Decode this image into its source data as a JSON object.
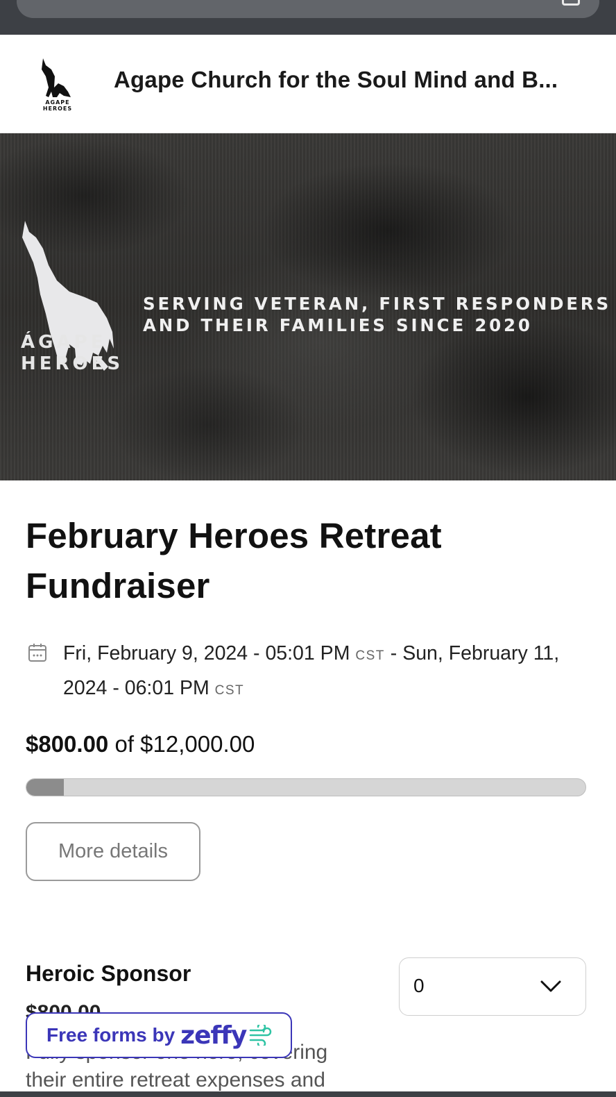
{
  "header": {
    "logo_text": "AGAPE HEROES",
    "title": "Agape Church for the Soul Mind and B..."
  },
  "banner": {
    "brand_line1": "ÁGAPE",
    "brand_line2": "HEROES",
    "tagline_line1": "SERVING VETERAN, FIRST RESPONDERS",
    "tagline_line2": "AND THEIR FAMILIES SINCE 2020"
  },
  "event": {
    "title": "February Heroes Retreat Fundraiser",
    "start": "Fri, February 9, 2024 - 05:01 PM",
    "start_tz": "CST",
    "end": "Sun, February 11, 2024 - 06:01 PM",
    "end_tz": "CST",
    "raised": "$800.00",
    "of_label": "of",
    "goal": "$12,000.00",
    "progress_fraction": 0.0667,
    "more_details_label": "More details"
  },
  "ticket": {
    "name": "Heroic Sponsor",
    "price": "$800.00",
    "description": "Fully sponsor one hero, covering their entire retreat expenses and",
    "quantity": "0"
  },
  "footer_badge": {
    "label": "Free forms by",
    "brand": "zeffy"
  },
  "colors": {
    "zeffy_purple": "#3b36b8",
    "progress_fill": "#8c8c8c",
    "progress_track": "#d6d6d6"
  }
}
